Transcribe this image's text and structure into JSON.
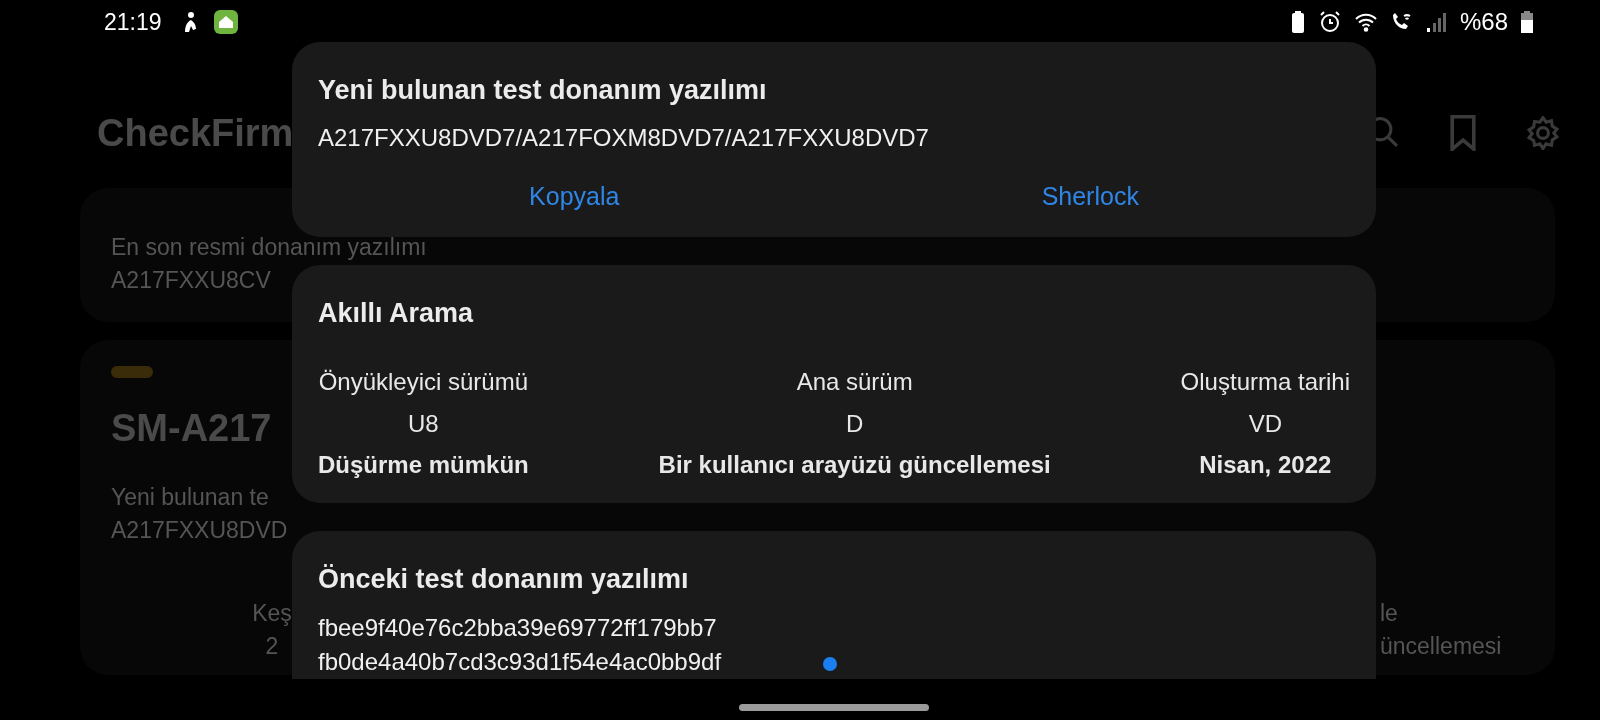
{
  "status_bar": {
    "time": "21:19",
    "battery": "%68"
  },
  "background": {
    "app_title": "CheckFirm",
    "cards": [
      {
        "subtitle": "En son resmi donanım yazılımı",
        "firmware": "A217FXXU8CV"
      },
      {
        "model": "SM-A217",
        "subtitle": "Yeni bulunan te",
        "firmware": "A217FXXU8DVD",
        "left_fragments": [
          "Keş",
          "2"
        ],
        "right_fragments": [
          "le",
          "üncellemesi"
        ]
      }
    ]
  },
  "dialogs": [
    {
      "kind": "actions",
      "title": "Yeni bulunan test donanım yazılımı",
      "lines": [
        "A217FXXU8DVD7/A217FOXM8DVD7/A217FXXU8DVD7"
      ],
      "buttons": [
        "Kopyala",
        "Sherlock"
      ]
    },
    {
      "kind": "columns",
      "title": "Akıllı Arama",
      "columns": [
        {
          "label": "Önyükleyici sürümü",
          "value": "U8",
          "note": "Düşürme mümkün"
        },
        {
          "label": "Ana sürüm",
          "value": "D",
          "note": "Bir kullanıcı arayüzü güncellemesi"
        },
        {
          "label": "Oluşturma tarihi",
          "value": "VD",
          "note": "Nisan, 2022"
        }
      ]
    },
    {
      "kind": "lines",
      "title": "Önceki test donanım yazılımı",
      "lines": [
        "fbee9f40e76c2bba39e69772ff179bb7",
        "fb0de4a40b7cd3c93d1f54e4ac0bb9df"
      ]
    }
  ]
}
